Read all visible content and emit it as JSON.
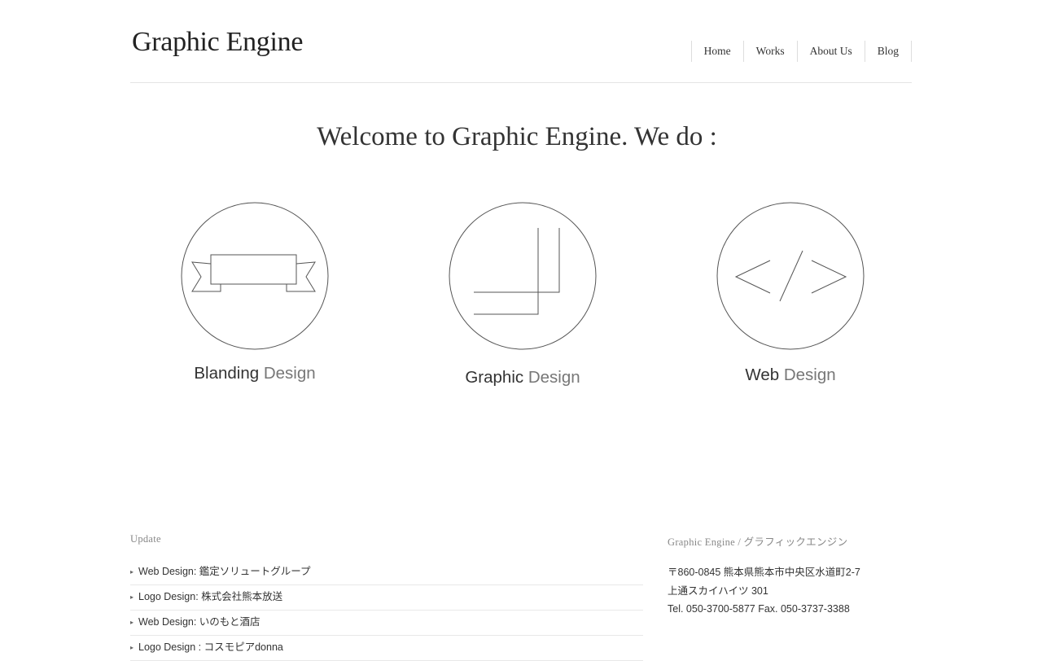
{
  "header": {
    "logo": "Graphic Engine",
    "nav": [
      "Home",
      "Works",
      "About Us",
      "Blog"
    ]
  },
  "welcome": "Welcome to Graphic Engine. We do :",
  "services": [
    {
      "strong": "Blanding",
      "light": "Design",
      "icon": "ribbon-banner-icon"
    },
    {
      "strong": "Graphic",
      "light": "Design",
      "icon": "crop-marks-icon"
    },
    {
      "strong": "Web",
      "light": "Design",
      "icon": "code-brackets-icon"
    }
  ],
  "footer": {
    "update_title": "Update",
    "updates": [
      "Web Design: 鑑定ソリュートグループ",
      "Logo Design: 株式会社熊本放送",
      "Web Design: いのもと酒店",
      "Logo Design : コスモピアdonna"
    ],
    "company_title": "Graphic Engine / グラフィックエンジン",
    "address": [
      "〒860-0845 熊本県熊本市中央区水道町2-7",
      "上通スカイハイツ 301",
      "Tel. 050-3700-5877 Fax. 050-3737-3388"
    ]
  }
}
